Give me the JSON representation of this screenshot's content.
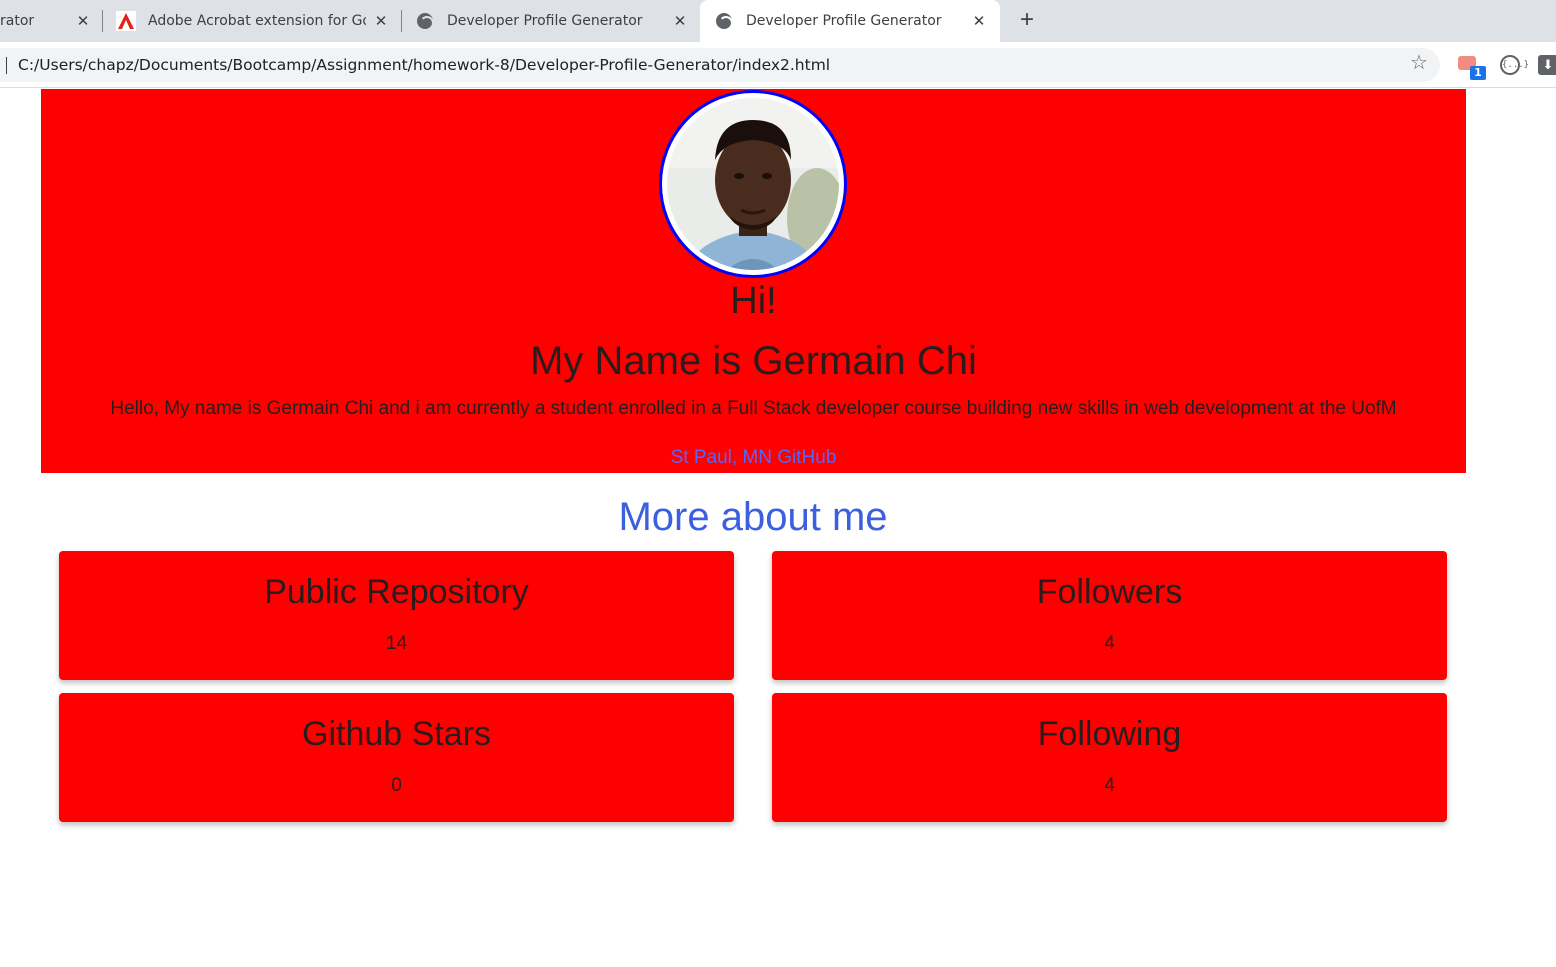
{
  "browser": {
    "tabs": [
      {
        "title": "rator"
      },
      {
        "title": "Adobe Acrobat extension for Goo"
      },
      {
        "title": "Developer Profile Generator"
      },
      {
        "title": "Developer Profile Generator"
      }
    ],
    "new_tab_label": "+",
    "close_label": "✕",
    "url": "C:/Users/chapz/Documents/Bootcamp/Assignment/homework-8/Developer-Profile-Generator/index2.html",
    "extension_badge": "1",
    "extension_code_label": "{...}",
    "icons": [
      "acrobat-icon",
      "globe-icon",
      "star-icon",
      "extension-icon",
      "download-icon"
    ]
  },
  "profile": {
    "greeting": "Hi!",
    "name_line": "My Name is Germain Chi",
    "bio": "Hello, My name is Germain Chi and i am currently a student enrolled in a Full Stack developer course building new skills in web development at the UofM",
    "location": "St Paul, MN",
    "github_link": "GitHub"
  },
  "section_title": "More about me",
  "stats": [
    {
      "label": "Public Repository",
      "value": "14"
    },
    {
      "label": "Followers",
      "value": "4"
    },
    {
      "label": "Github Stars",
      "value": "0"
    },
    {
      "label": "Following",
      "value": "4"
    }
  ],
  "colors": {
    "hero_bg": "#ff0000",
    "avatar_border": "#0000ff",
    "section_title": "#3c5fe0",
    "link": "#5566ff"
  }
}
